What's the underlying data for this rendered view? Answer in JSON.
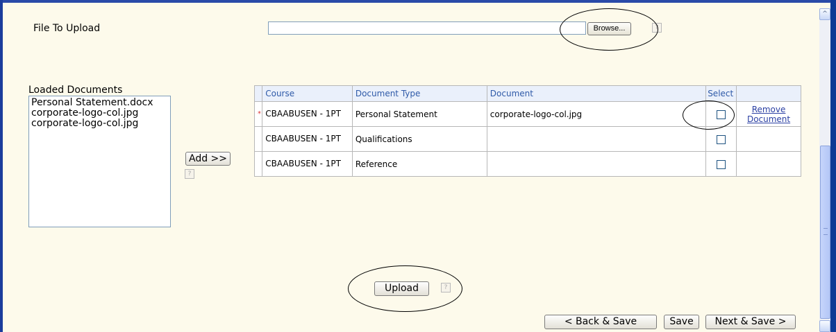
{
  "upload": {
    "label": "File To Upload",
    "file_value": "",
    "browse_label": "Browse...",
    "help": "?"
  },
  "loaded": {
    "label": "Loaded Documents",
    "items": [
      "Personal Statement.docx",
      "corporate-logo-col.jpg",
      "corporate-logo-col.jpg"
    ]
  },
  "add": {
    "label": "Add >>",
    "help": "?"
  },
  "table": {
    "headers": [
      "Course",
      "Document Type",
      "Document",
      "Select",
      ""
    ],
    "required_marker": "*",
    "rows": [
      {
        "course": "CBAABUSEN - 1PT",
        "type": "Personal Statement",
        "document": "corporate-logo-col.jpg",
        "selected": false,
        "action": "Remove Document",
        "required": true
      },
      {
        "course": "CBAABUSEN - 1PT",
        "type": "Qualifications",
        "document": "",
        "selected": false,
        "action": "",
        "required": false
      },
      {
        "course": "CBAABUSEN - 1PT",
        "type": "Reference",
        "document": "",
        "selected": false,
        "action": "",
        "required": false
      }
    ]
  },
  "actions": {
    "upload": "Upload",
    "upload_help": "?",
    "back_save": "< Back & Save",
    "save": "Save",
    "next_save": "Next & Save >"
  },
  "scrollbar": {
    "up_icon": "^"
  }
}
